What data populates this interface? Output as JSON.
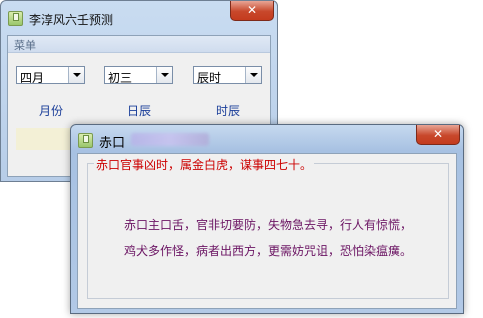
{
  "main_window": {
    "title": "李淳风六壬预测",
    "close_glyph": "✕",
    "menu": {
      "label": "菜单"
    },
    "selects": [
      {
        "value": "四月",
        "label": "月份"
      },
      {
        "value": "初三",
        "label": "日辰"
      },
      {
        "value": "辰时",
        "label": "时辰"
      }
    ]
  },
  "dialog": {
    "title": "赤口",
    "close_glyph": "✕",
    "group_title": "赤口官事凶时，属金白虎，谋事四七十。",
    "lines": [
      "赤口主口舌，官非切要防，失物急去寻，行人有惊慌，",
      "鸡犬多作怪，病者出西方，更需妨咒诅，恐怕染瘟癀。"
    ]
  },
  "colors": {
    "legend_text": "#cc0000",
    "body_text": "#6b1463",
    "field_label": "#1c3f9a",
    "close_button": "#c8482b"
  },
  "icons": [
    "app-icon",
    "close-icon",
    "dropdown-arrow-icon"
  ]
}
